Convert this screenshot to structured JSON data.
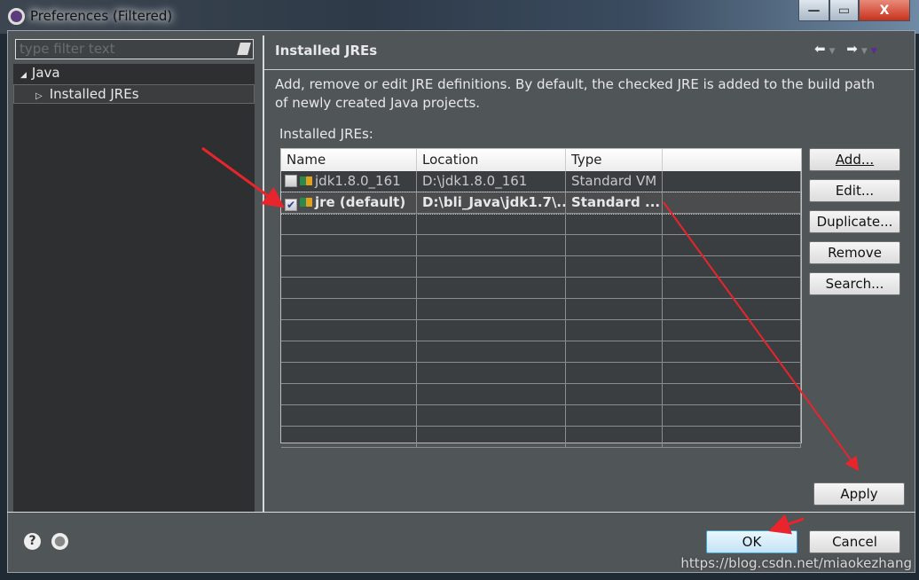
{
  "window": {
    "title": "Preferences (Filtered)",
    "controls": {
      "minimize": "—",
      "maximize": "▭",
      "close": "X"
    }
  },
  "sidebar": {
    "filter_placeholder": "type filter text",
    "tree": [
      {
        "label": "Java",
        "expanded": true
      },
      {
        "label": "Installed JREs",
        "selected": true
      }
    ]
  },
  "page": {
    "title": "Installed JREs",
    "description": "Add, remove or edit JRE definitions. By default, the checked JRE is added to the build path of newly created Java projects.",
    "table_label": "Installed JREs:"
  },
  "table": {
    "columns": [
      "Name",
      "Location",
      "Type"
    ],
    "rows": [
      {
        "name": "jdk1.8.0_161",
        "location": "D:\\jdk1.8.0_161",
        "type": "Standard VM",
        "checked": false
      },
      {
        "name": "jre (default)",
        "location": "D:\\bli_Java\\jdk1.7\\...",
        "type": "Standard ...",
        "checked": true
      }
    ]
  },
  "buttons": {
    "add": "Add...",
    "edit": "Edit...",
    "duplicate": "Duplicate...",
    "remove": "Remove",
    "search": "Search...",
    "apply": "Apply",
    "ok": "OK",
    "cancel": "Cancel"
  },
  "watermark": "https://blog.csdn.net/miaokezhang",
  "colors": {
    "annotation_arrow": "#e8242c",
    "dialog_bg": "#505558"
  }
}
